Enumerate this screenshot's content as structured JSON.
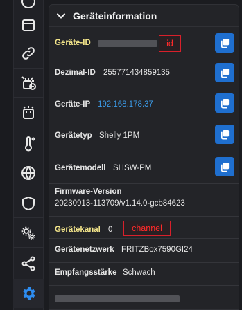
{
  "panel": {
    "title": "Geräteinformation"
  },
  "rows": [
    {
      "label": "Geräte-ID",
      "value": "",
      "annotation": "id",
      "copy": true
    },
    {
      "label": "Dezimal-ID",
      "value": "255771434859135",
      "copy": true
    },
    {
      "label": "Geräte-IP",
      "value": "192.168.178.37",
      "copy": true
    },
    {
      "label": "Gerätetyp",
      "value": "Shelly 1PM",
      "copy": true
    },
    {
      "label": "Gerätemodell",
      "value": "SHSW-PM",
      "copy": true
    },
    {
      "label": "Firmware-Version",
      "value": "20230913-113709/v1.14.0-gcb84623"
    },
    {
      "label": "Gerätekanal",
      "value": "0",
      "annotation": "channel"
    },
    {
      "label": "Gerätenetzwerk",
      "value": "FRITZBox7590GI24"
    },
    {
      "label": "Empfangsstärke",
      "value": "Schwach"
    },
    {
      "label": "",
      "value": ""
    }
  ],
  "sidebar": {
    "icons": [
      "clock-icon",
      "calendar-icon",
      "link-icon",
      "plug-scene-icon",
      "socket-icon",
      "thermometer-icon",
      "globe-icon",
      "shield-icon",
      "gears-icon",
      "share-icon",
      "settings-icon"
    ]
  },
  "colors": {
    "accent": "#1f6fcf",
    "highlight_label": "#f2e48a",
    "link": "#3b9be8",
    "annotation": "#d8202b"
  }
}
